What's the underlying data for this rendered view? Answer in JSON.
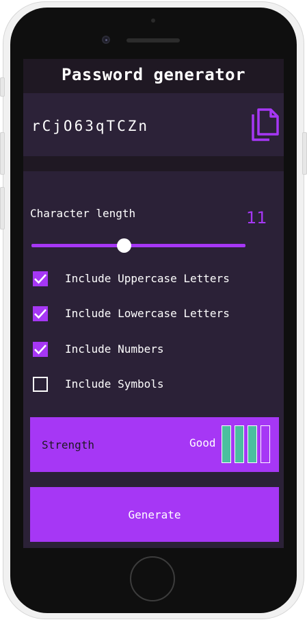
{
  "app": {
    "title": "Password generator",
    "password": "rCjO63qTCZn",
    "copy_icon": "copy-icon"
  },
  "length": {
    "label": "Character length",
    "value": "11",
    "slider_fraction": 0.42
  },
  "options": [
    {
      "label": "Include Uppercase Letters",
      "checked": true
    },
    {
      "label": "Include Lowercase Letters",
      "checked": true
    },
    {
      "label": "Include Numbers",
      "checked": true
    },
    {
      "label": "Include Symbols",
      "checked": false
    }
  ],
  "strength": {
    "label": "Strength",
    "value": "Good",
    "level": 3,
    "max_level": 4
  },
  "generate": {
    "label": "Generate"
  },
  "colors": {
    "accent": "#a637f5",
    "background": "#2b2137",
    "header": "#1f1823",
    "strength_bar": "#4bbf9f"
  }
}
